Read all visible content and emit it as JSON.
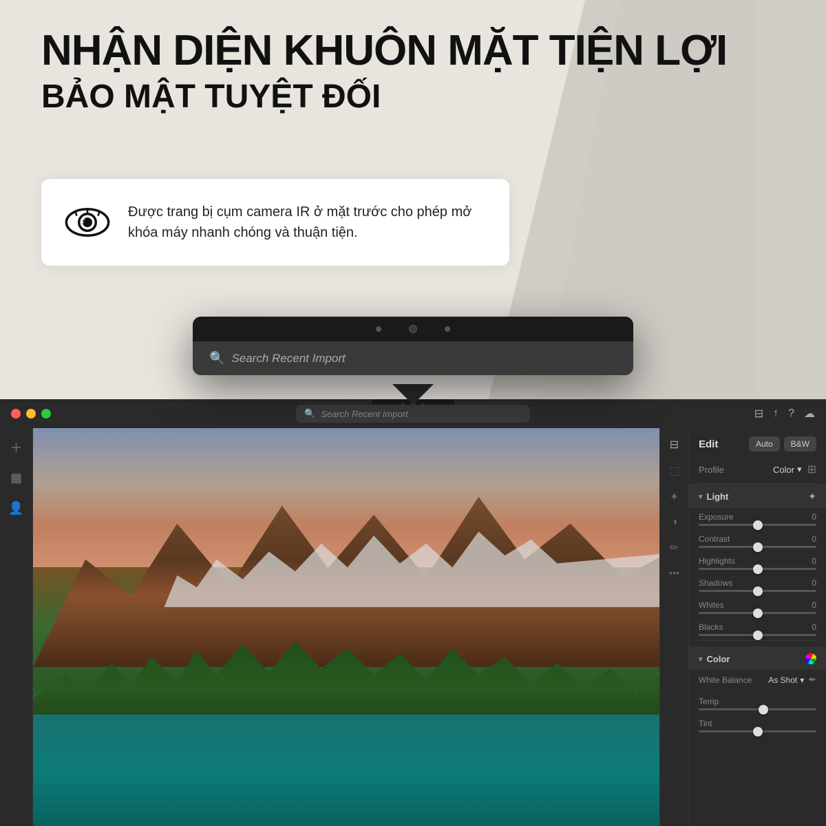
{
  "header": {
    "title_line1": "NHẬN DIỆN KHUÔN MẶT TIỆN LỢI",
    "title_line2": "BẢO MẬT TUYỆT ĐỐI",
    "description": "Được trang bị cụm camera IR ở mặt trước cho phép mở khóa máy nhanh chóng và thuận tiện."
  },
  "search": {
    "placeholder": "Search Recent Import"
  },
  "edit_panel": {
    "edit_label": "Edit",
    "auto_label": "Auto",
    "bw_label": "B&W",
    "profile_label": "Profile",
    "profile_value": "Color",
    "light_section": "Light",
    "sliders": [
      {
        "label": "Exposure",
        "value": "0",
        "position": 50
      },
      {
        "label": "Contrast",
        "value": "0",
        "position": 50
      },
      {
        "label": "Highlights",
        "value": "0",
        "position": 50
      },
      {
        "label": "Shadows",
        "value": "0",
        "position": 50
      },
      {
        "label": "Whites",
        "value": "0",
        "position": 50
      },
      {
        "label": "Blacks",
        "value": "0",
        "position": 50
      }
    ],
    "color_section": "Color",
    "white_balance_label": "White Balance",
    "white_balance_value": "As Shot",
    "temp_label": "Temp",
    "tint_label": "Tint"
  },
  "sidebar": {
    "icons": [
      "＋",
      "▦",
      "👤"
    ]
  }
}
